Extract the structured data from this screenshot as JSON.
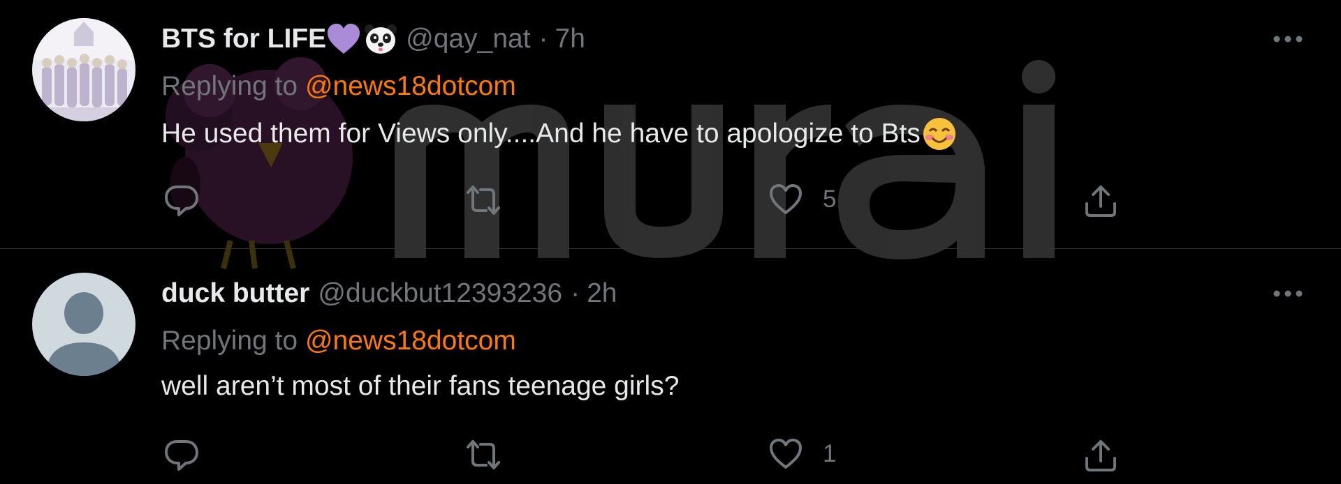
{
  "watermark": {
    "text": "murai"
  },
  "tweets": [
    {
      "display_name": "BTS for LIFE",
      "name_emojis": [
        "purple-heart",
        "panda-face"
      ],
      "handle": "@qay_nat",
      "separator": "·",
      "time": "7h",
      "replying_prefix": "Replying to ",
      "replying_to": "@news18dotcom",
      "text": "He used them for Views only....And he have to apologize to Bts",
      "text_emoji": "smiling-face-with-blush",
      "reply_count": "",
      "retweet_count": "",
      "like_count": "5"
    },
    {
      "display_name": "duck butter",
      "name_emojis": [],
      "handle": "@duckbut12393236",
      "separator": "·",
      "time": "2h",
      "replying_prefix": "Replying to ",
      "replying_to": "@news18dotcom",
      "text": "well aren’t most of their fans teenage girls?",
      "text_emoji": "",
      "reply_count": "",
      "retweet_count": "",
      "like_count": "1"
    }
  ],
  "colors": {
    "background": "#000000",
    "text_primary": "#e7e9ea",
    "text_secondary": "#71767b",
    "mention": "#ff7a00",
    "divider": "#2f3336"
  },
  "icons": {
    "reply": "reply-icon",
    "retweet": "retweet-icon",
    "like": "like-icon",
    "share": "share-icon",
    "more": "more-icon"
  }
}
